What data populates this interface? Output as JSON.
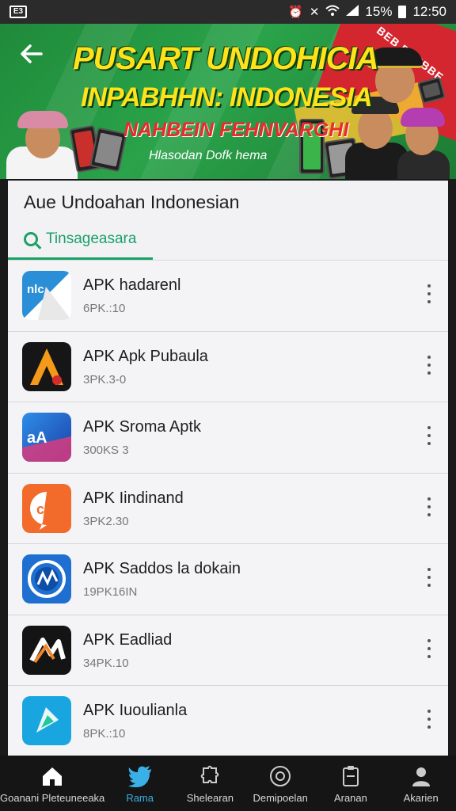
{
  "status_bar": {
    "sim_label": "E3",
    "battery_percent": "15%",
    "time": "12:50"
  },
  "banner": {
    "title_line1": "PUSART UNDOHICIA",
    "title_line2": "INPABHHN: INDONESIA",
    "title_line3": "NAHBEIN FEHNVARGHI",
    "subtitle": "Hlasodan Dofk hema",
    "corner_text": "BEB BERBBE",
    "colors": {
      "green": "#2aa34a",
      "yellow": "#ffe21a",
      "red": "#d3262f"
    }
  },
  "section": {
    "title": "Aue Undoahan Indonesian",
    "search_label": "Tinsageasara",
    "accent_color": "#1aa068"
  },
  "apps": [
    {
      "name": "APK hadarenl",
      "meta": "6PK.:10",
      "icon": "app-icon-blue-white"
    },
    {
      "name": "APK Apk Pubaula",
      "meta": "3PK.3-0",
      "icon": "app-icon-black-orange-a"
    },
    {
      "name": "APK Sroma Aptk",
      "meta": "300KS 3",
      "icon": "app-icon-blue-gradient"
    },
    {
      "name": "APK Iindinand",
      "meta": "3PK2.30",
      "icon": "app-icon-orange"
    },
    {
      "name": "APK Saddos la dokain",
      "meta": "19PK16IN",
      "icon": "app-icon-blue-circle"
    },
    {
      "name": "APK Eadliad",
      "meta": "34PK.10",
      "icon": "app-icon-black-knot"
    },
    {
      "name": "APK Iuoulianla",
      "meta": "8PK.:10",
      "icon": "app-icon-cyan"
    }
  ],
  "bottom_nav": [
    {
      "label": "Goanani Pleteuneeaka",
      "icon": "home-icon",
      "active": false
    },
    {
      "label": "Rama",
      "icon": "bird-icon",
      "active": true
    },
    {
      "label": "Shelearan",
      "icon": "puzzle-icon",
      "active": false
    },
    {
      "label": "Demipoelan",
      "icon": "circle-smile-icon",
      "active": false
    },
    {
      "label": "Aranan",
      "icon": "clipboard-icon",
      "active": false
    },
    {
      "label": "Akarien",
      "icon": "person-icon",
      "active": false
    }
  ]
}
